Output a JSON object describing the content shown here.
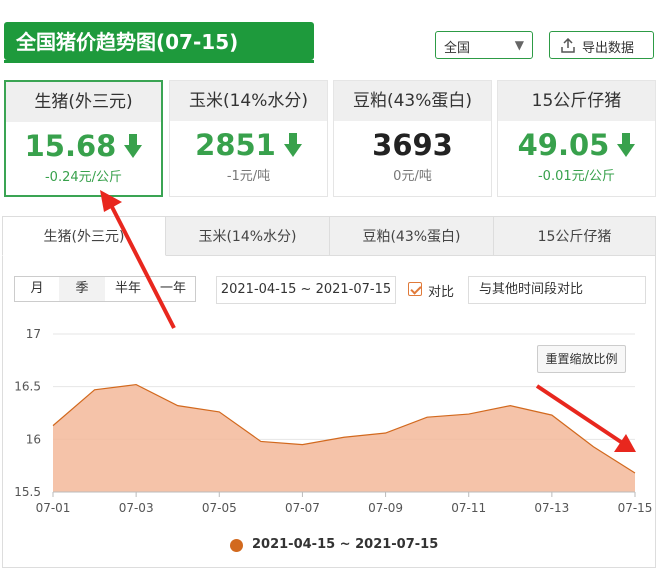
{
  "header": {
    "title": "全国猪价趋势图(07-15)",
    "region": "全国",
    "export_label": "导出数据"
  },
  "cards": [
    {
      "name": "生猪(外三元)",
      "price": "15.68",
      "change": "-0.24元/公斤",
      "trend": "down",
      "active": true
    },
    {
      "name": "玉米(14%水分)",
      "price": "2851",
      "change": "-1元/吨",
      "trend": "down",
      "active": false
    },
    {
      "name": "豆粕(43%蛋白)",
      "price": "3693",
      "change": "0元/吨",
      "trend": "flat",
      "active": false
    },
    {
      "name": "15公斤仔猪",
      "price": "49.05",
      "change": "-0.01元/公斤",
      "trend": "down",
      "active": false
    }
  ],
  "tabs": [
    "生猪(外三元)",
    "玉米(14%水分)",
    "豆粕(43%蛋白)",
    "15公斤仔猪"
  ],
  "controls": {
    "periods": [
      "月",
      "季",
      "半年",
      "一年"
    ],
    "active_period": "季",
    "date_range": "2021-04-15 ~ 2021-07-15",
    "compare_label": "对比",
    "compare_checked": true,
    "compare_input": "与其他时间段对比",
    "reset_label": "重置缩放比例"
  },
  "colors": {
    "brand_green": "#1e9a3c",
    "price_green": "#38a14c",
    "series_line": "#d2691e",
    "series_fill": "#f3b89a",
    "annotation_arrow": "#e8271e"
  },
  "chart_data": {
    "type": "area",
    "x": [
      "07-01",
      "07-02",
      "07-03",
      "07-04",
      "07-05",
      "07-06",
      "07-07",
      "07-08",
      "07-09",
      "07-10",
      "07-11",
      "07-12",
      "07-13",
      "07-14",
      "07-15"
    ],
    "series": [
      {
        "name": "2021-04-15 ~ 2021-07-15",
        "values": [
          16.13,
          16.47,
          16.52,
          16.32,
          16.26,
          15.98,
          15.95,
          16.02,
          16.06,
          16.21,
          16.24,
          16.32,
          16.23,
          15.93,
          15.68
        ]
      }
    ],
    "x_tick_labels": [
      "07-01",
      "07-03",
      "07-05",
      "07-07",
      "07-09",
      "07-11",
      "07-13",
      "07-15"
    ],
    "y_tick_labels": [
      "15.5",
      "16",
      "16.5",
      "17"
    ],
    "ylim": [
      15.5,
      17
    ],
    "grid": true,
    "legend": "bottom-center"
  }
}
